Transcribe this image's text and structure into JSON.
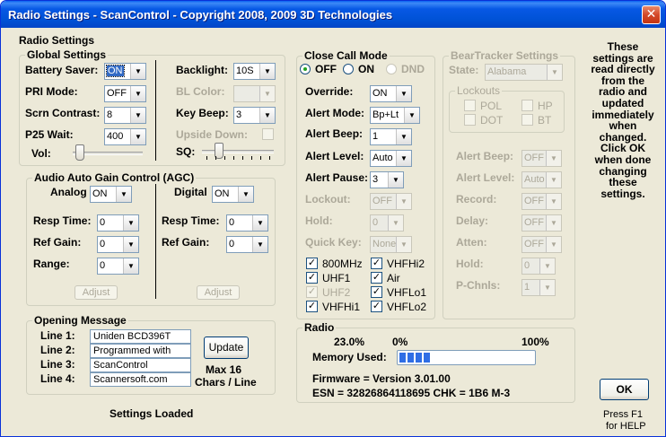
{
  "window": {
    "title": "Radio Settings - ScanControl - Copyright 2008, 2009 3D Technologies",
    "close_glyph": "✕"
  },
  "radio_settings": {
    "title": "Radio Settings"
  },
  "global": {
    "title": "Global Settings",
    "battery_saver": {
      "label": "Battery Saver:",
      "value": "ON"
    },
    "pri_mode": {
      "label": "PRI Mode:",
      "value": "OFF"
    },
    "scrn_contrast": {
      "label": "Scrn Contrast:",
      "value": "8"
    },
    "p25_wait": {
      "label": "P25 Wait:",
      "value": "400"
    },
    "vol": {
      "label": "Vol:",
      "level": 0.05
    },
    "backlight": {
      "label": "Backlight:",
      "value": "10S"
    },
    "bl_color": {
      "label": "BL Color:",
      "value": ""
    },
    "key_beep": {
      "label": "Key Beep:",
      "value": "3"
    },
    "upside_down": {
      "label": "Upside Down:",
      "checked": false
    },
    "sq": {
      "label": "SQ:",
      "level": 0.2
    }
  },
  "agc": {
    "title": "Audio Auto Gain Control (AGC)",
    "analog": {
      "label": "Analog",
      "value": "ON",
      "resp_label": "Resp Time:",
      "resp": "0",
      "ref_label": "Ref Gain:",
      "ref": "0",
      "range_label": "Range:",
      "range": "0",
      "adjust": "Adjust"
    },
    "digital": {
      "label": "Digital",
      "value": "ON",
      "resp_label": "Resp Time:",
      "resp": "0",
      "ref_label": "Ref Gain:",
      "ref": "0",
      "adjust": "Adjust"
    }
  },
  "opening": {
    "title": "Opening Message",
    "l1": "Line 1:",
    "l2": "Line 2:",
    "l3": "Line 3:",
    "l4": "Line 4:",
    "v1": "Uniden  BCD396T",
    "v2": "Programmed with",
    "v3": " ScanControl",
    "v4": "Scannersoft.com",
    "update": "Update",
    "max1": "Max 16",
    "max2": "Chars / Line"
  },
  "status": "Settings Loaded",
  "closecall": {
    "title": "Close Call Mode",
    "off": "OFF",
    "on": "ON",
    "dnd": "DND",
    "override": {
      "label": "Override:",
      "value": "ON"
    },
    "alert_mode": {
      "label": "Alert Mode:",
      "value": "Bp+Lt"
    },
    "alert_beep": {
      "label": "Alert Beep:",
      "value": "1"
    },
    "alert_level": {
      "label": "Alert Level:",
      "value": "Auto"
    },
    "alert_pause": {
      "label": "Alert Pause:",
      "value": "3"
    },
    "lockout": {
      "label": "Lockout:",
      "value": "OFF"
    },
    "hold": {
      "label": "Hold:",
      "value": "0"
    },
    "quick_key": {
      "label": "Quick Key:",
      "value": "None"
    },
    "bands": [
      {
        "label": "800MHz",
        "checked": true,
        "disabled": false
      },
      {
        "label": "VHFHi2",
        "checked": true,
        "disabled": false
      },
      {
        "label": "UHF1",
        "checked": true,
        "disabled": false
      },
      {
        "label": "Air",
        "checked": true,
        "disabled": false
      },
      {
        "label": "UHF2",
        "checked": true,
        "disabled": true
      },
      {
        "label": "VHFLo1",
        "checked": true,
        "disabled": false
      },
      {
        "label": "VHFHi1",
        "checked": true,
        "disabled": false
      },
      {
        "label": "VHFLo2",
        "checked": true,
        "disabled": false
      }
    ],
    "check_glyph": "✓"
  },
  "bear": {
    "title": "BearTracker Settings",
    "state": {
      "label": "State:",
      "value": "Alabama"
    },
    "lockouts": {
      "title": "Lockouts",
      "pol": "POL",
      "hp": "HP",
      "dot": "DOT",
      "bt": "BT"
    },
    "alert_beep": {
      "label": "Alert Beep:",
      "value": "OFF"
    },
    "alert_level": {
      "label": "Alert Level:",
      "value": "Auto"
    },
    "record": {
      "label": "Record:",
      "value": "OFF"
    },
    "delay": {
      "label": "Delay:",
      "value": "OFF"
    },
    "atten": {
      "label": "Atten:",
      "value": "OFF"
    },
    "hold": {
      "label": "Hold:",
      "value": "0"
    },
    "pchnls": {
      "label": "P-Chnls:",
      "value": "1"
    }
  },
  "radio": {
    "title": "Radio",
    "pct": "23.0%",
    "min": "0%",
    "max": "100%",
    "mem_label": "Memory Used:",
    "mem_fraction": 0.23,
    "firmware": "Firmware =   Version 3.01.00",
    "esn": "ESN = 32826864118695    CHK = 1B6   M-3"
  },
  "info": [
    "These",
    "settings are",
    "read directly",
    "from the",
    "radio and",
    "updated",
    "immediately",
    "when",
    "changed.",
    "Click OK",
    "when done",
    "changing",
    "these",
    "settings."
  ],
  "ok": "OK",
  "help1": "Press F1",
  "help2": "for HELP",
  "arrow_glyph": "▼"
}
